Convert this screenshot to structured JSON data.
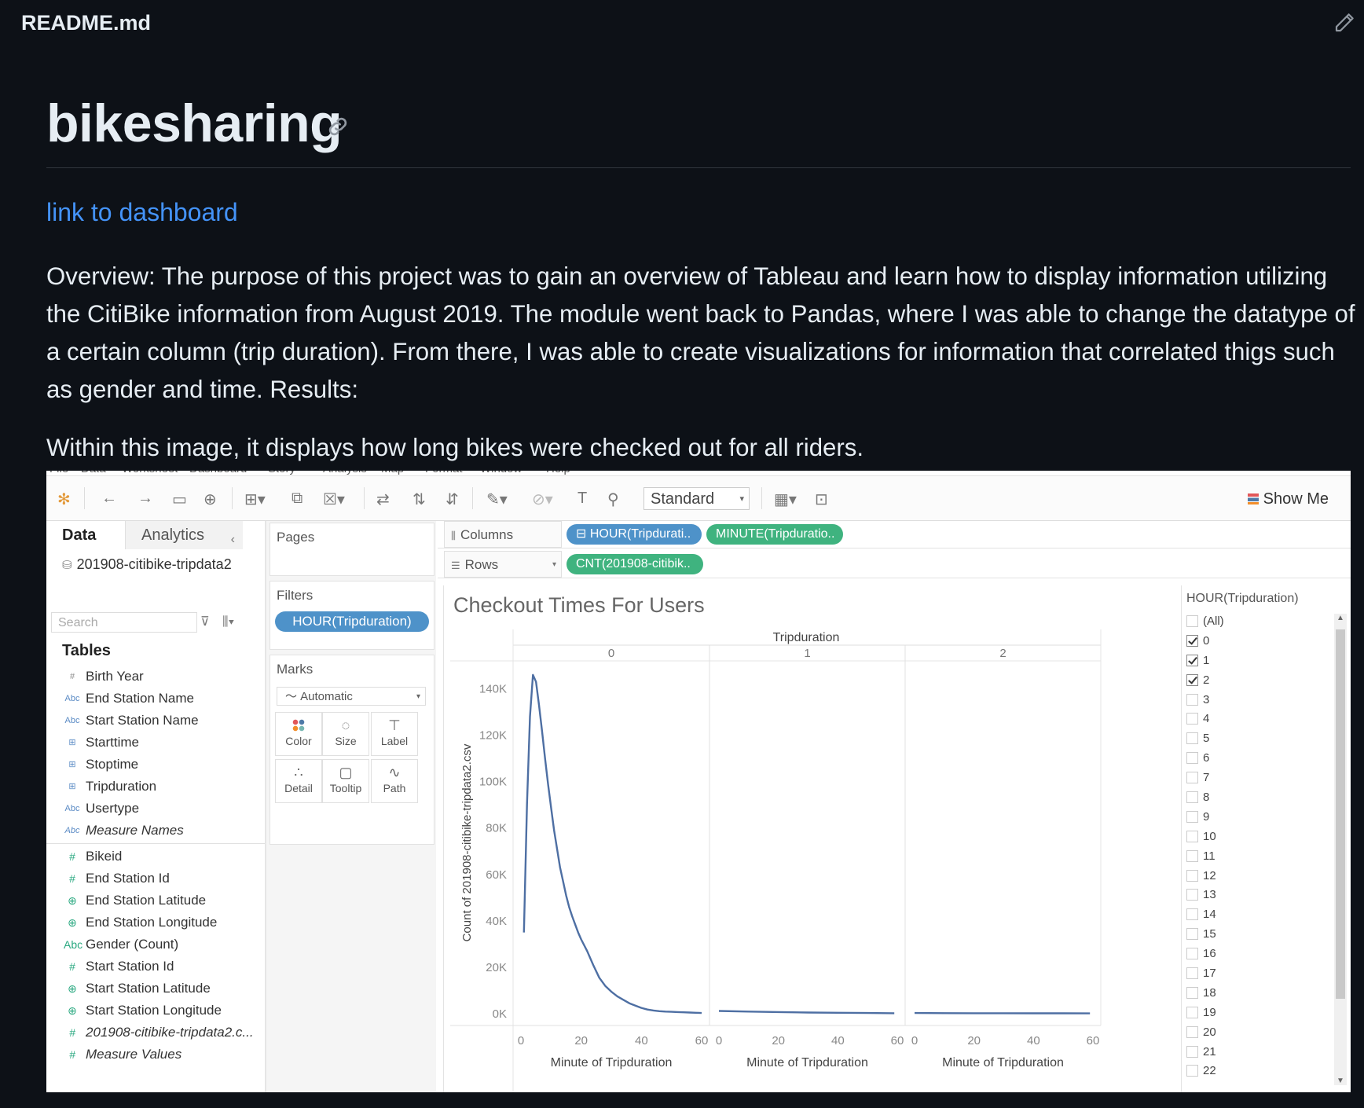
{
  "readme": {
    "file_name": "README.md",
    "title": "bikesharing",
    "link_text": "link to dashboard",
    "overview": "Overview: The purpose of this project was to gain an overview of Tableau and learn how to display information utilizing the CitiBike information from August 2019. The module went back to Pandas, where I was able to change the datatype of a certain column (trip duration). From there, I was able to create visualizations for information that correlated thigs such as gender and time. Results:",
    "caption": "Within this image, it displays how long bikes were checked out for all riders."
  },
  "tableau": {
    "menu": [
      "File",
      "Data",
      "Worksheet",
      "Dashboard",
      "Story",
      "Analysis",
      "Map",
      "Format",
      "Window",
      "Help"
    ],
    "toolbar": {
      "fit_select": "Standard",
      "show_me": "Show Me"
    },
    "left_pane": {
      "tab_data": "Data",
      "tab_analytics": "Analytics",
      "data_source": "201908-citibike-tripdata2",
      "search_placeholder": "Search",
      "tables_heading": "Tables",
      "dimensions": [
        {
          "type": "#",
          "name": "Birth Year"
        },
        {
          "type": "Abc",
          "name": "End Station Name"
        },
        {
          "type": "Abc",
          "name": "Start Station Name"
        },
        {
          "type": "date",
          "name": "Starttime"
        },
        {
          "type": "date",
          "name": "Stoptime"
        },
        {
          "type": "date",
          "name": "Tripduration"
        },
        {
          "type": "Abc",
          "name": "Usertype"
        },
        {
          "type": "Abc",
          "name": "Measure Names",
          "italic": true
        }
      ],
      "measures": [
        {
          "type": "#",
          "name": "Bikeid"
        },
        {
          "type": "#",
          "name": "End Station Id"
        },
        {
          "type": "geo",
          "name": "End Station Latitude"
        },
        {
          "type": "geo",
          "name": "End Station Longitude"
        },
        {
          "type": "Abc",
          "name": "Gender (Count)"
        },
        {
          "type": "#",
          "name": "Start Station Id"
        },
        {
          "type": "geo",
          "name": "Start Station Latitude"
        },
        {
          "type": "geo",
          "name": "Start Station Longitude"
        },
        {
          "type": "#",
          "name": "201908-citibike-tripdata2.c...",
          "italic": true
        },
        {
          "type": "#",
          "name": "Measure Values",
          "italic": true
        }
      ]
    },
    "cards": {
      "pages": "Pages",
      "filters": "Filters",
      "filter_pill": "HOUR(Tripduration)",
      "marks": "Marks",
      "marks_type": "Automatic",
      "mark_buttons": [
        "Color",
        "Size",
        "Label",
        "Detail",
        "Tooltip",
        "Path"
      ]
    },
    "shelves": {
      "columns_label": "Columns",
      "rows_label": "Rows",
      "columns_pills": [
        "HOUR(Tripdurati..",
        "MINUTE(Tripduratio.."
      ],
      "rows_pills": [
        "CNT(201908-citibik.."
      ]
    },
    "filter_card": {
      "title": "HOUR(Tripduration)",
      "items": [
        {
          "label": "(All)",
          "checked": false
        },
        {
          "label": "0",
          "checked": true
        },
        {
          "label": "1",
          "checked": true
        },
        {
          "label": "2",
          "checked": true
        },
        {
          "label": "3",
          "checked": false
        },
        {
          "label": "4",
          "checked": false
        },
        {
          "label": "5",
          "checked": false
        },
        {
          "label": "6",
          "checked": false
        },
        {
          "label": "7",
          "checked": false
        },
        {
          "label": "8",
          "checked": false
        },
        {
          "label": "9",
          "checked": false
        },
        {
          "label": "10",
          "checked": false
        },
        {
          "label": "11",
          "checked": false
        },
        {
          "label": "12",
          "checked": false
        },
        {
          "label": "13",
          "checked": false
        },
        {
          "label": "14",
          "checked": false
        },
        {
          "label": "15",
          "checked": false
        },
        {
          "label": "16",
          "checked": false
        },
        {
          "label": "17",
          "checked": false
        },
        {
          "label": "18",
          "checked": false
        },
        {
          "label": "19",
          "checked": false
        },
        {
          "label": "20",
          "checked": false
        },
        {
          "label": "21",
          "checked": false
        },
        {
          "label": "22",
          "checked": false
        }
      ]
    }
  },
  "colors": {
    "line": "#4e6fa3",
    "link": "#4493f8",
    "pill_blue": "#4e92c9",
    "pill_green": "#3fb37f"
  },
  "chart_data": {
    "type": "line",
    "title": "Checkout Times For Users",
    "header_label": "Tripduration",
    "panels": [
      "0",
      "1",
      "2"
    ],
    "xlabel": "Minute of Tripduration",
    "ylabel": "Count of 201908-citibike-tripdata2.csv",
    "xlim": [
      0,
      60
    ],
    "xticks": [
      0,
      20,
      40,
      60
    ],
    "ylim": [
      0,
      150000
    ],
    "yticks": [
      0,
      20000,
      40000,
      60000,
      80000,
      100000,
      120000,
      140000
    ],
    "ytick_labels": [
      "0K",
      "20K",
      "40K",
      "60K",
      "80K",
      "100K",
      "120K",
      "140K"
    ],
    "grid": false,
    "series": [
      {
        "panel": "0",
        "x": [
          1,
          2,
          3,
          4,
          5,
          6,
          7,
          8,
          9,
          10,
          11,
          12,
          13,
          14,
          15,
          16,
          17,
          18,
          19,
          20,
          22,
          24,
          26,
          28,
          30,
          32,
          34,
          36,
          38,
          40,
          42,
          44,
          46,
          48,
          50,
          52,
          54,
          56,
          58,
          60
        ],
        "y": [
          35000,
          90000,
          128000,
          146000,
          143000,
          133000,
          122000,
          110000,
          99000,
          89000,
          79000,
          71000,
          63000,
          57000,
          51000,
          46000,
          42000,
          38500,
          35000,
          32000,
          27000,
          21000,
          15500,
          12000,
          9500,
          7500,
          6000,
          4500,
          3500,
          2500,
          1800,
          1400,
          1100,
          900,
          800,
          700,
          600,
          500,
          400,
          300
        ]
      },
      {
        "panel": "1",
        "x": [
          0,
          10,
          20,
          30,
          40,
          50,
          59
        ],
        "y": [
          1200,
          900,
          700,
          500,
          400,
          300,
          200
        ]
      },
      {
        "panel": "2",
        "x": [
          0,
          10,
          20,
          30,
          40,
          50,
          59
        ],
        "y": [
          300,
          250,
          220,
          200,
          180,
          160,
          150
        ]
      }
    ]
  }
}
